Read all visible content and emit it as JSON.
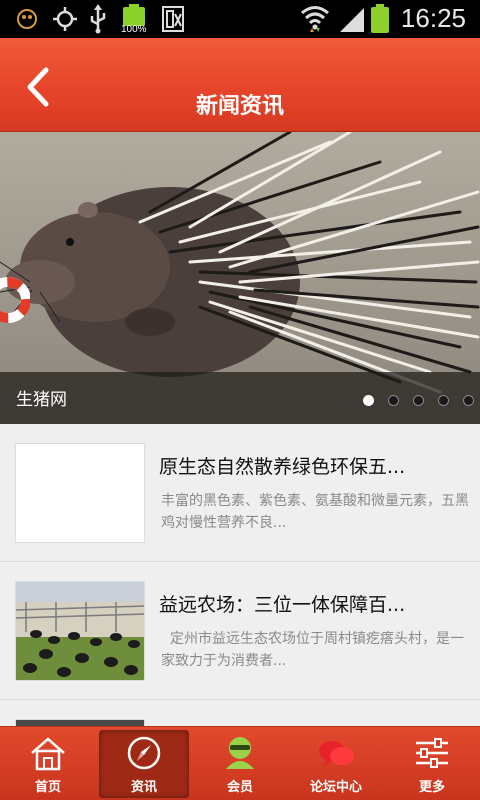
{
  "status_bar": {
    "time": "16:25",
    "battery_label": "100%"
  },
  "header": {
    "title": "新闻资讯"
  },
  "banner": {
    "caption": "生猪网",
    "slide_count": 5,
    "active_slide": 1
  },
  "news": [
    {
      "title": "原生态自然散养绿色环保五...",
      "summary": "丰富的黑色素、紫色素、氨基酸和微量元素，五黑鸡对慢性营养不良..."
    },
    {
      "title": "益远农场：三位一体保障百...",
      "summary": "定州市益远生态农场位于周村镇疙瘩头村，是一家致力于为消费者..."
    }
  ],
  "bottom_nav": {
    "items": [
      {
        "label": "首页",
        "icon": "home-icon"
      },
      {
        "label": "资讯",
        "icon": "compass-icon"
      },
      {
        "label": "会员",
        "icon": "member-icon"
      },
      {
        "label": "论坛中心",
        "icon": "chat-bubbles-icon"
      },
      {
        "label": "更多",
        "icon": "sliders-icon"
      }
    ],
    "active_index": 1
  },
  "colors": {
    "brand_red": "#e6452a",
    "nav_active": "#9e2a16"
  }
}
